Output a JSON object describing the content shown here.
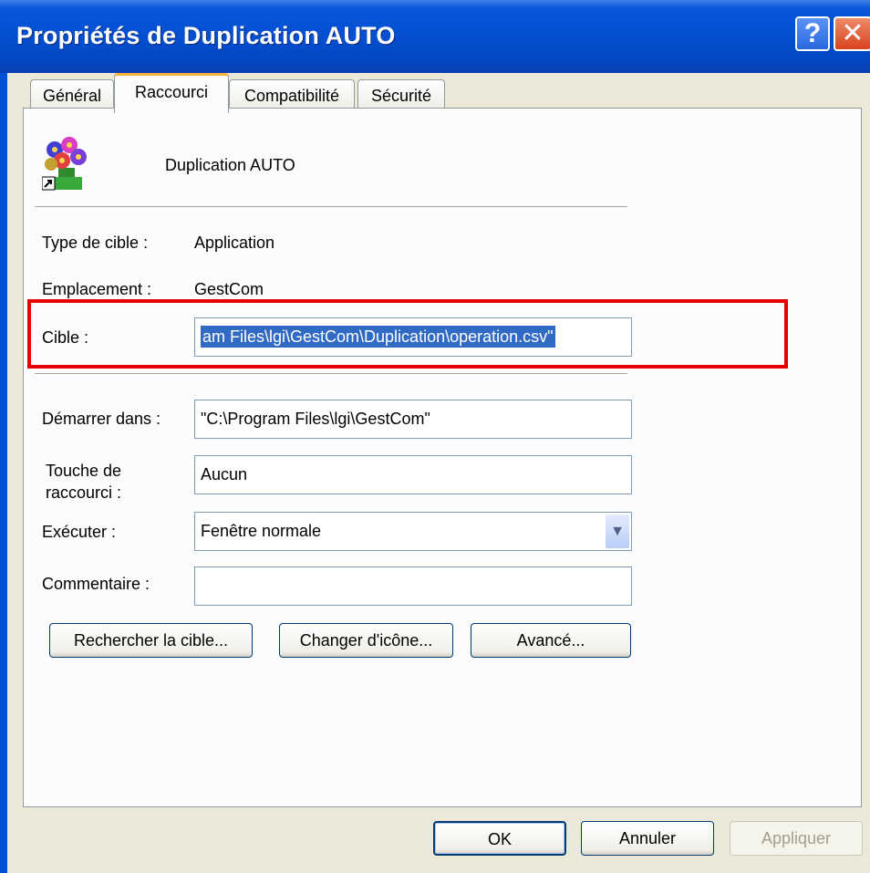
{
  "window": {
    "title": "Propriétés de Duplication AUTO",
    "help_label": "?",
    "close_label": "✕"
  },
  "tabs": [
    {
      "label": "Général",
      "active": false
    },
    {
      "label": "Raccourci",
      "active": true
    },
    {
      "label": "Compatibilité",
      "active": false
    },
    {
      "label": "Sécurité",
      "active": false
    }
  ],
  "shortcut": {
    "icon": "flower-bouquet-shortcut-icon",
    "name": "Duplication AUTO",
    "type_label": "Type de cible :",
    "type_value": "Application",
    "location_label": "Emplacement :",
    "location_value": "GestCom",
    "target_label": "Cible :",
    "target_value": "am Files\\lgi\\GestCom\\Duplication\\operation.csv\"",
    "start_label": "Démarrer dans :",
    "start_value": "\"C:\\Program Files\\lgi\\GestCom\"",
    "hotkey_label": "Touche de raccourci :",
    "hotkey_value": "Aucun",
    "run_label": "Exécuter :",
    "run_value": "Fenêtre normale",
    "comment_label": "Commentaire :",
    "comment_value": ""
  },
  "buttons": {
    "find_target": "Rechercher la cible...",
    "change_icon": "Changer d'icône...",
    "advanced": "Avancé...",
    "ok": "OK",
    "cancel": "Annuler",
    "apply": "Appliquer"
  },
  "colors": {
    "titlebar": "#0550d2",
    "selection": "#316ac5",
    "highlight": "#e60000"
  }
}
